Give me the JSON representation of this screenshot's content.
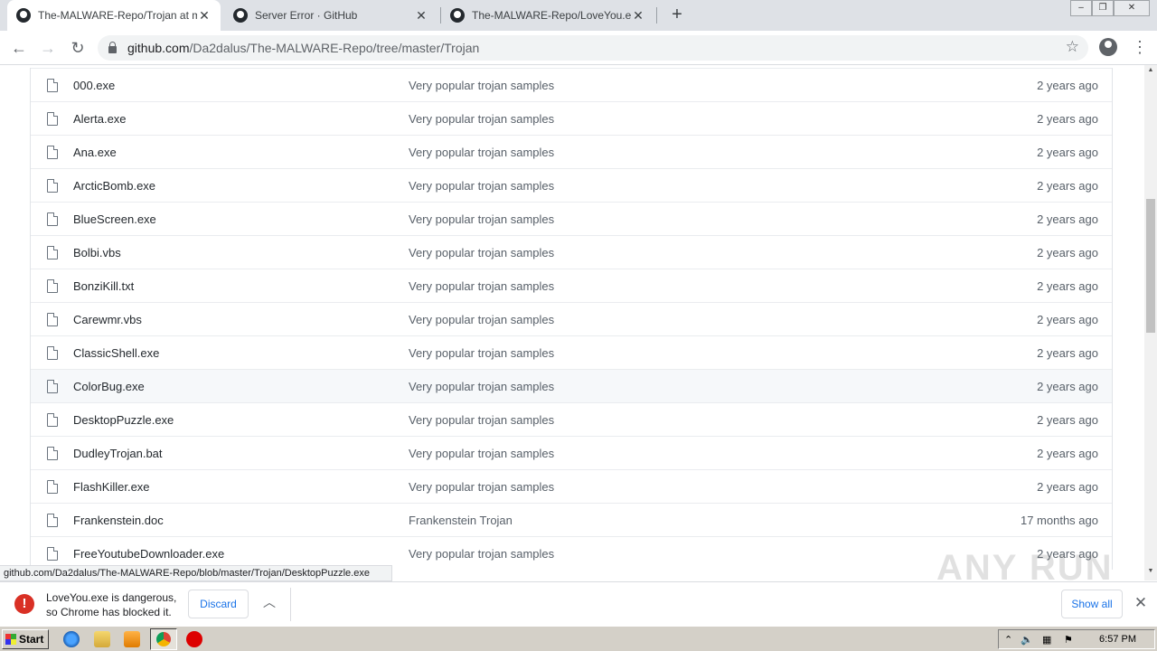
{
  "browser": {
    "tabs": [
      {
        "title": "The-MALWARE-Repo/Trojan at mast",
        "active": true
      },
      {
        "title": "Server Error · GitHub",
        "active": false
      },
      {
        "title": "The-MALWARE-Repo/LoveYou.exe a",
        "active": false
      }
    ],
    "url_host": "github.com",
    "url_path": "/Da2dalus/The-MALWARE-Repo/tree/master/Trojan"
  },
  "files": [
    {
      "name": "000.exe",
      "message": "Very popular trojan samples",
      "age": "2 years ago"
    },
    {
      "name": "Alerta.exe",
      "message": "Very popular trojan samples",
      "age": "2 years ago"
    },
    {
      "name": "Ana.exe",
      "message": "Very popular trojan samples",
      "age": "2 years ago"
    },
    {
      "name": "ArcticBomb.exe",
      "message": "Very popular trojan samples",
      "age": "2 years ago"
    },
    {
      "name": "BlueScreen.exe",
      "message": "Very popular trojan samples",
      "age": "2 years ago"
    },
    {
      "name": "Bolbi.vbs",
      "message": "Very popular trojan samples",
      "age": "2 years ago"
    },
    {
      "name": "BonziKill.txt",
      "message": "Very popular trojan samples",
      "age": "2 years ago"
    },
    {
      "name": "Carewmr.vbs",
      "message": "Very popular trojan samples",
      "age": "2 years ago"
    },
    {
      "name": "ClassicShell.exe",
      "message": "Very popular trojan samples",
      "age": "2 years ago"
    },
    {
      "name": "ColorBug.exe",
      "message": "Very popular trojan samples",
      "age": "2 years ago"
    },
    {
      "name": "DesktopPuzzle.exe",
      "message": "Very popular trojan samples",
      "age": "2 years ago"
    },
    {
      "name": "DudleyTrojan.bat",
      "message": "Very popular trojan samples",
      "age": "2 years ago"
    },
    {
      "name": "FlashKiller.exe",
      "message": "Very popular trojan samples",
      "age": "2 years ago"
    },
    {
      "name": "Frankenstein.doc",
      "message": "Frankenstein Trojan",
      "age": "17 months ago"
    },
    {
      "name": "FreeYoutubeDownloader.exe",
      "message": "Very popular trojan samples",
      "age": "2 years ago"
    }
  ],
  "status_url": "github.com/Da2dalus/The-MALWARE-Repo/blob/master/Trojan/DesktopPuzzle.exe",
  "watermark": "ANY RUN",
  "download_bar": {
    "line1": "LoveYou.exe is dangerous,",
    "line2": "so Chrome has blocked it.",
    "discard": "Discard",
    "show_all": "Show all"
  },
  "taskbar": {
    "start": "Start",
    "clock": "6:57 PM"
  }
}
